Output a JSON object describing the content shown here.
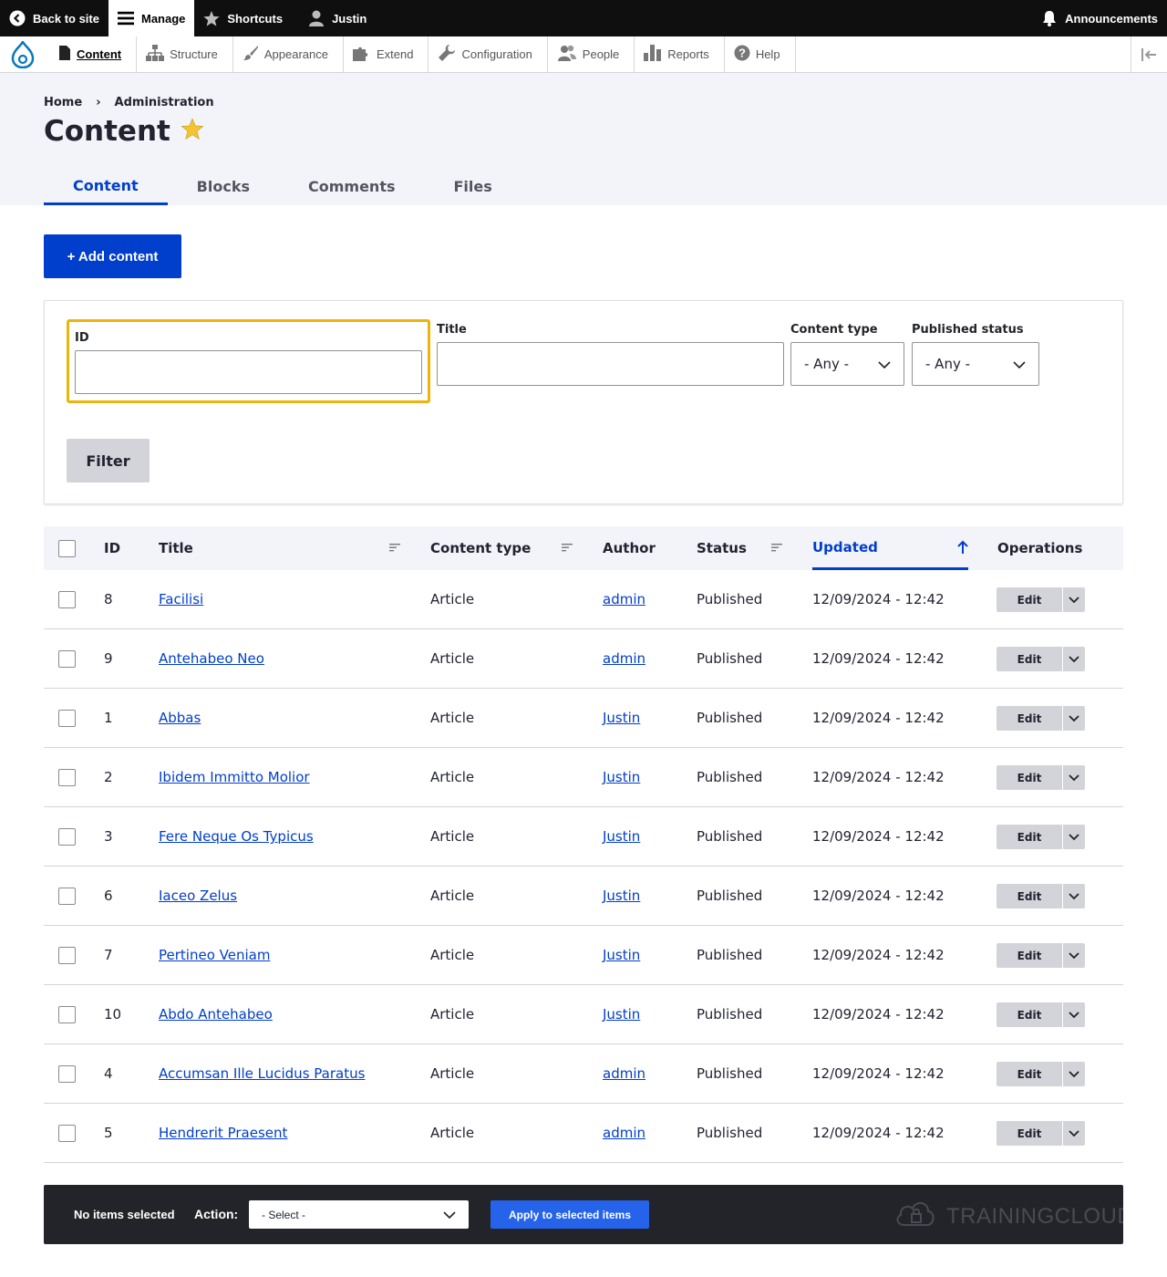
{
  "toolbar": {
    "back_to_site": "Back to site",
    "manage": "Manage",
    "shortcuts": "Shortcuts",
    "user": "Justin",
    "announcements": "Announcements"
  },
  "subnav": {
    "items": [
      {
        "label": "Content",
        "icon": "page-icon"
      },
      {
        "label": "Structure",
        "icon": "structure-icon"
      },
      {
        "label": "Appearance",
        "icon": "brush-icon"
      },
      {
        "label": "Extend",
        "icon": "puzzle-icon"
      },
      {
        "label": "Configuration",
        "icon": "wrench-icon"
      },
      {
        "label": "People",
        "icon": "people-icon"
      },
      {
        "label": "Reports",
        "icon": "bar-chart-icon"
      },
      {
        "label": "Help",
        "icon": "help-icon"
      }
    ]
  },
  "breadcrumb": {
    "home": "Home",
    "separator": "›",
    "admin": "Administration"
  },
  "page": {
    "title": "Content"
  },
  "tabs": [
    "Content",
    "Blocks",
    "Comments",
    "Files"
  ],
  "add_button": "+ Add content",
  "filters": {
    "id_label": "ID",
    "title_label": "Title",
    "type_label": "Content type",
    "type_value": "- Any -",
    "status_label": "Published status",
    "status_value": "- Any -",
    "filter_button": "Filter"
  },
  "table": {
    "headers": {
      "id": "ID",
      "title": "Title",
      "type": "Content type",
      "author": "Author",
      "status": "Status",
      "updated": "Updated",
      "operations": "Operations"
    },
    "edit_label": "Edit",
    "rows": [
      {
        "id": "8",
        "title": "Facilisi",
        "type": "Article",
        "author": "admin",
        "status": "Published",
        "updated": "12/09/2024 - 12:42"
      },
      {
        "id": "9",
        "title": "Antehabeo Neo",
        "type": "Article",
        "author": "admin",
        "status": "Published",
        "updated": "12/09/2024 - 12:42"
      },
      {
        "id": "1",
        "title": "Abbas",
        "type": "Article",
        "author": "Justin",
        "status": "Published",
        "updated": "12/09/2024 - 12:42"
      },
      {
        "id": "2",
        "title": "Ibidem Immitto Molior",
        "type": "Article",
        "author": "Justin",
        "status": "Published",
        "updated": "12/09/2024 - 12:42"
      },
      {
        "id": "3",
        "title": "Fere Neque Os Typicus",
        "type": "Article",
        "author": "Justin",
        "status": "Published",
        "updated": "12/09/2024 - 12:42"
      },
      {
        "id": "6",
        "title": "Iaceo Zelus",
        "type": "Article",
        "author": "Justin",
        "status": "Published",
        "updated": "12/09/2024 - 12:42"
      },
      {
        "id": "7",
        "title": "Pertineo Veniam",
        "type": "Article",
        "author": "Justin",
        "status": "Published",
        "updated": "12/09/2024 - 12:42"
      },
      {
        "id": "10",
        "title": "Abdo Antehabeo",
        "type": "Article",
        "author": "Justin",
        "status": "Published",
        "updated": "12/09/2024 - 12:42"
      },
      {
        "id": "4",
        "title": "Accumsan Ille Lucidus Paratus",
        "type": "Article",
        "author": "admin",
        "status": "Published",
        "updated": "12/09/2024 - 12:42"
      },
      {
        "id": "5",
        "title": "Hendrerit Praesent",
        "type": "Article",
        "author": "admin",
        "status": "Published",
        "updated": "12/09/2024 - 12:42"
      }
    ]
  },
  "bulk": {
    "count": "No items selected",
    "action_label": "Action:",
    "select_value": "- Select -",
    "apply": "Apply to selected items",
    "watermark": "TRAININGCLOUD"
  },
  "colors": {
    "accent": "#003ecc",
    "focus": "#ebb50a",
    "toolbar": "#0f0f0f",
    "header_bg": "#f3f4f9"
  }
}
